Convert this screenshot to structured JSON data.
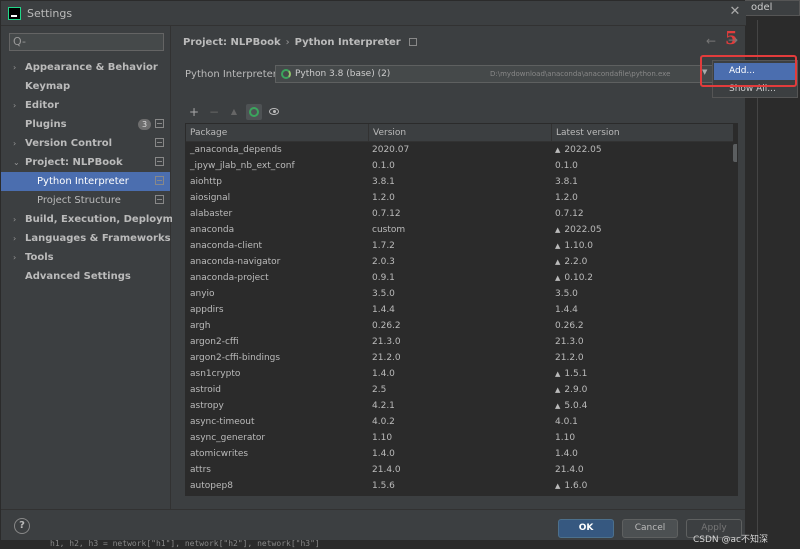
{
  "window": {
    "title": "Settings",
    "close_glyph": "✕"
  },
  "ide": {
    "tab_label": "odel",
    "bottom_code": "h1, h2, h3 = network[\"h1\"], network[\"h2\"], network[\"h3\"]"
  },
  "search": {
    "placeholder": "Q-"
  },
  "sidebar": {
    "items": [
      {
        "label": "Appearance & Behavior",
        "arrow": "›"
      },
      {
        "label": "Keymap",
        "arrow": ""
      },
      {
        "label": "Editor",
        "arrow": "›"
      },
      {
        "label": "Plugins",
        "arrow": "",
        "badge": "3"
      },
      {
        "label": "Version Control",
        "arrow": "›"
      },
      {
        "label": "Project: NLPBook",
        "arrow": "⌄"
      },
      {
        "label": "Python Interpreter",
        "arrow": ""
      },
      {
        "label": "Project Structure",
        "arrow": ""
      },
      {
        "label": "Build, Execution, Deployment",
        "arrow": "›"
      },
      {
        "label": "Languages & Frameworks",
        "arrow": "›"
      },
      {
        "label": "Tools",
        "arrow": "›"
      },
      {
        "label": "Advanced Settings",
        "arrow": ""
      }
    ]
  },
  "breadcrumb": {
    "project": "Project: NLPBook",
    "sep": "›",
    "page": "Python Interpreter"
  },
  "nav": {
    "back": "←",
    "forward": "→"
  },
  "annotation": {
    "step": "5"
  },
  "interpreter": {
    "label": "Python Interpreter:",
    "name": "Python 3.8 (base) (2)",
    "path": "D:\\mydownload\\anaconda\\anacondafile\\python.exe",
    "dropdown": [
      "Add...",
      "Show All..."
    ]
  },
  "toolbar": {
    "add": "+",
    "remove": "−",
    "upgrade": "▲"
  },
  "table": {
    "headers": [
      "Package",
      "Version",
      "Latest version"
    ],
    "rows": [
      [
        "_anaconda_depends",
        "2020.07",
        "2022.05",
        true
      ],
      [
        "_ipyw_jlab_nb_ext_conf",
        "0.1.0",
        "0.1.0",
        false
      ],
      [
        "aiohttp",
        "3.8.1",
        "3.8.1",
        false
      ],
      [
        "aiosignal",
        "1.2.0",
        "1.2.0",
        false
      ],
      [
        "alabaster",
        "0.7.12",
        "0.7.12",
        false
      ],
      [
        "anaconda",
        "custom",
        "2022.05",
        true
      ],
      [
        "anaconda-client",
        "1.7.2",
        "1.10.0",
        true
      ],
      [
        "anaconda-navigator",
        "2.0.3",
        "2.2.0",
        true
      ],
      [
        "anaconda-project",
        "0.9.1",
        "0.10.2",
        true
      ],
      [
        "anyio",
        "3.5.0",
        "3.5.0",
        false
      ],
      [
        "appdirs",
        "1.4.4",
        "1.4.4",
        false
      ],
      [
        "argh",
        "0.26.2",
        "0.26.2",
        false
      ],
      [
        "argon2-cffi",
        "21.3.0",
        "21.3.0",
        false
      ],
      [
        "argon2-cffi-bindings",
        "21.2.0",
        "21.2.0",
        false
      ],
      [
        "asn1crypto",
        "1.4.0",
        "1.5.1",
        true
      ],
      [
        "astroid",
        "2.5",
        "2.9.0",
        true
      ],
      [
        "astropy",
        "4.2.1",
        "5.0.4",
        true
      ],
      [
        "async-timeout",
        "4.0.2",
        "4.0.1",
        false
      ],
      [
        "async_generator",
        "1.10",
        "1.10",
        false
      ],
      [
        "atomicwrites",
        "1.4.0",
        "1.4.0",
        false
      ],
      [
        "attrs",
        "21.4.0",
        "21.4.0",
        false
      ],
      [
        "autopep8",
        "1.5.6",
        "1.6.0",
        true
      ]
    ]
  },
  "footer": {
    "help": "?",
    "ok": "OK",
    "cancel": "Cancel",
    "apply": "Apply"
  },
  "watermark": "CSDN @ac不知深"
}
